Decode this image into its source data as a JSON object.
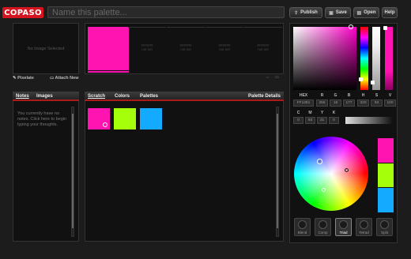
{
  "header": {
    "logo": "COPASO",
    "title_placeholder": "Name this palette...",
    "buttons": [
      {
        "label": "Publish",
        "icon": "publish-icon"
      },
      {
        "label": "Save",
        "icon": "save-icon"
      },
      {
        "label": "Open",
        "icon": "open-icon"
      },
      {
        "label": "Help"
      }
    ]
  },
  "image_panel": {
    "placeholder": "No Image Selected",
    "pixelate_label": "Pixelate",
    "attach_label": "Attach New"
  },
  "palette_strip": {
    "slots": [
      {
        "color": "#FF1381",
        "filled": true
      },
      {
        "hex": "######",
        "status": "not set"
      },
      {
        "hex": "######",
        "status": "not set"
      },
      {
        "hex": "######",
        "status": "not set"
      },
      {
        "hex": "######",
        "status": "not set"
      }
    ]
  },
  "notes_panel": {
    "tabs": [
      "Notes",
      "Images"
    ],
    "active_tab": "Notes",
    "text": "You currently have no notes. Click here to begin typing your thoughts."
  },
  "scratch_panel": {
    "tabs": [
      "Scratch",
      "Colors",
      "Palettes"
    ],
    "active_tab": "Scratch",
    "details_label": "Palette Details",
    "swatches": [
      "#ff13b1",
      "#a6ff0a",
      "#13aaff"
    ]
  },
  "color_picker": {
    "hex_label": "HEX",
    "hex_value": "FF1381",
    "rgb_labels": [
      "R",
      "G",
      "B"
    ],
    "rgb_values": [
      "255",
      "18",
      "177"
    ],
    "hsv_labels": [
      "H",
      "S",
      "V"
    ],
    "hsv_values": [
      "320",
      "93",
      "100"
    ],
    "cmyk_labels": [
      "C",
      "M",
      "Y",
      "K"
    ],
    "cmyk_values": [
      "0",
      "93",
      "31",
      "0"
    ],
    "base_color": "#ff00c8"
  },
  "harmony": {
    "swatches": [
      "#ff13b1",
      "#a6ff0a",
      "#13aaff"
    ],
    "modes": [
      "Blend",
      "Comp",
      "Triad",
      "Tetrad",
      "Split"
    ],
    "active_mode": "Triad"
  }
}
